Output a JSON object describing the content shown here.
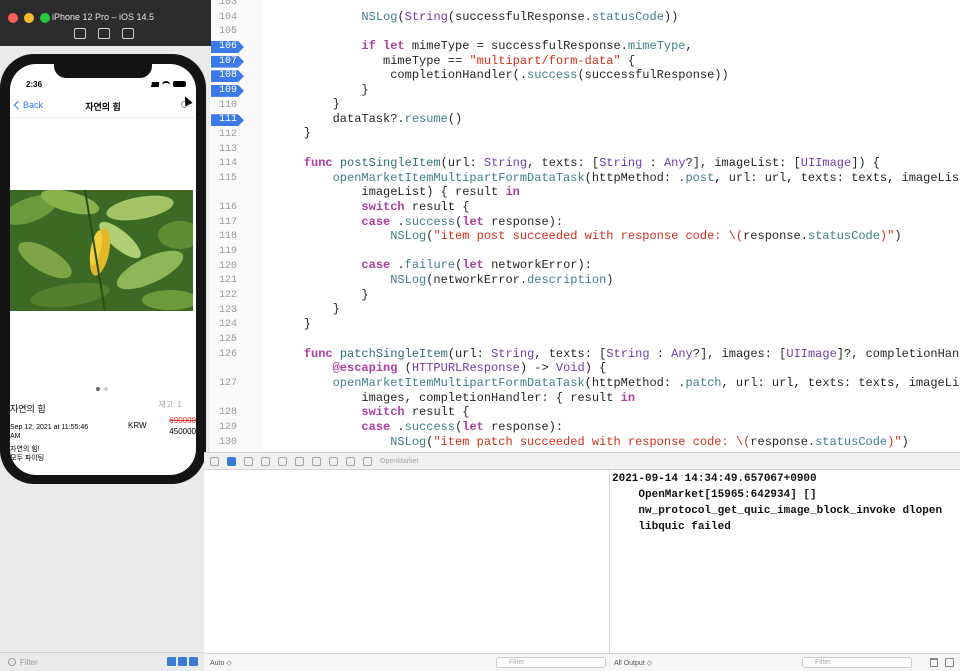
{
  "simulator": {
    "title": "iPhone 12 Pro – iOS 14.5",
    "status_time": "2:36",
    "nav": {
      "back_label": "Back",
      "title": "자연의 힘"
    },
    "product": {
      "name": "자연의 힘",
      "stock": "재고: 1",
      "date": "Sep 12, 2021 at 11:55:46 AM",
      "currency": "KRW",
      "original_price": "690000",
      "discounted_price": "450000",
      "description_line1": "자연의 힘!",
      "description_line2": "모두 파이팅"
    },
    "page_count": 2
  },
  "debugbar": {
    "scheme_label": "OpenMarket"
  },
  "editor": {
    "line_numbers": [
      "103",
      "104",
      "105",
      "106",
      "107",
      "108",
      "109",
      "110",
      "111",
      "112",
      "113",
      "114",
      "115",
      "",
      "116",
      "117",
      "118",
      "119",
      "120",
      "121",
      "122",
      "123",
      "124",
      "125",
      "126",
      "",
      "127",
      "",
      "128",
      "129",
      "130"
    ],
    "breakpoints": [
      "106",
      "107",
      "108",
      "109",
      "111"
    ]
  },
  "console": {
    "lines": [
      "2021-09-14 14:34:49.657067+0900",
      "    OpenMarket[15965:642934] []",
      "    nw_protocol_get_quic_image_block_invoke dlopen",
      "    libquic failed"
    ]
  },
  "bottombar": {
    "vars_scope": "Auto ◇",
    "filter_placeholder": "Filter",
    "output_scope": "All Output ◇"
  },
  "navigator": {
    "filter_placeholder": "Filter"
  },
  "colors": {
    "breakpoint": "#3b7ae8",
    "keyword": "#ad3da4",
    "string": "#d12f1b"
  }
}
